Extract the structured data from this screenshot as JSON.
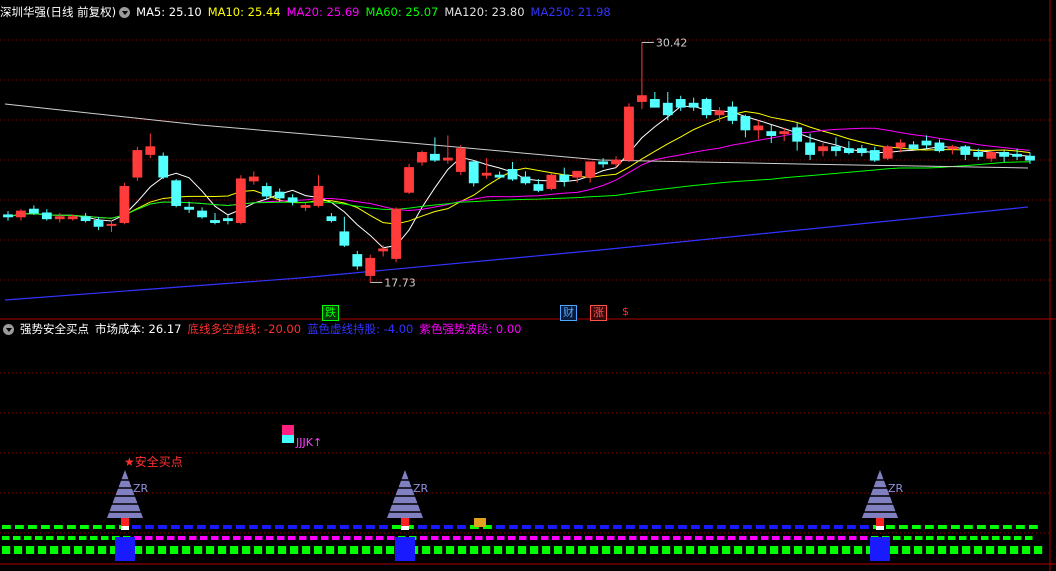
{
  "main": {
    "title": "深圳华强(日线 前复权)",
    "ma": [
      {
        "label": "MA5: 25.10",
        "color": "#ffffff"
      },
      {
        "label": "MA10: 25.44",
        "color": "#ffff00"
      },
      {
        "label": "MA20: 25.69",
        "color": "#ff00ff"
      },
      {
        "label": "MA60: 25.07",
        "color": "#00ff00"
      },
      {
        "label": "MA120: 23.80",
        "color": "#e0e0e0"
      },
      {
        "label": "MA250: 21.98",
        "color": "#3333ff"
      }
    ],
    "high_label": "30.42",
    "low_label": "17.73",
    "markers": [
      {
        "text": "跌",
        "color": "#00ff00",
        "bg": "#0a3a0a"
      },
      {
        "text": "财",
        "color": "#4da6ff",
        "bg": "#0a1a3a"
      },
      {
        "text": "涨",
        "color": "#ff5050",
        "bg": "#3a0a0a"
      },
      {
        "text": "$",
        "color": "#ff3030",
        "bg": "transparent"
      }
    ]
  },
  "indicator": {
    "title": "强势安全买点",
    "items": [
      {
        "label": "市场成本: 26.17",
        "color": "#ffffff"
      },
      {
        "label": "底线多空虚线: -20.00",
        "color": "#ff3030"
      },
      {
        "label": "蓝色虚线持股: -4.00",
        "color": "#3333ff"
      },
      {
        "label": "紫色强势波段: 0.00",
        "color": "#ff00ff"
      }
    ],
    "buy_signal": "★安全买点",
    "zr_label": "ZR",
    "jk_label": "JJJK↑"
  },
  "colors": {
    "up": "#ff3b3b",
    "down": "#54ffff",
    "grid": "#8b0000"
  },
  "chart_data": {
    "type": "candlestick",
    "candles": [
      [
        21.3,
        21.5,
        21.0,
        21.2
      ],
      [
        21.2,
        21.6,
        21.0,
        21.5
      ],
      [
        21.6,
        21.8,
        21.3,
        21.4
      ],
      [
        21.4,
        21.6,
        21.0,
        21.1
      ],
      [
        21.1,
        21.4,
        20.9,
        21.2
      ],
      [
        21.1,
        21.3,
        21.0,
        21.2
      ],
      [
        21.2,
        21.4,
        20.9,
        21.0
      ],
      [
        21.0,
        21.2,
        20.5,
        20.7
      ],
      [
        20.8,
        21.0,
        20.4,
        20.8
      ],
      [
        20.9,
        23.0,
        20.8,
        22.8
      ],
      [
        23.3,
        24.9,
        23.1,
        24.7
      ],
      [
        24.5,
        25.6,
        24.3,
        24.9
      ],
      [
        24.4,
        24.6,
        23.2,
        23.3
      ],
      [
        23.1,
        23.2,
        21.7,
        21.8
      ],
      [
        21.7,
        22.0,
        21.4,
        21.6
      ],
      [
        21.5,
        21.7,
        21.1,
        21.2
      ],
      [
        21.0,
        21.4,
        20.8,
        20.9
      ],
      [
        21.1,
        21.3,
        20.8,
        21.0
      ],
      [
        20.9,
        23.4,
        20.8,
        23.2
      ],
      [
        23.1,
        23.6,
        22.9,
        23.3
      ],
      [
        22.8,
        23.0,
        22.1,
        22.3
      ],
      [
        22.5,
        22.7,
        22.0,
        22.2
      ],
      [
        22.2,
        22.4,
        21.8,
        22.0
      ],
      [
        21.7,
        21.9,
        21.5,
        21.8
      ],
      [
        21.8,
        23.4,
        21.7,
        22.8
      ],
      [
        21.2,
        21.4,
        20.9,
        21.0
      ],
      [
        20.4,
        21.2,
        19.6,
        19.7
      ],
      [
        19.2,
        19.4,
        18.4,
        18.6
      ],
      [
        18.1,
        19.2,
        17.73,
        19.0
      ],
      [
        19.4,
        19.7,
        19.1,
        19.5
      ],
      [
        19.0,
        21.7,
        18.8,
        21.6
      ],
      [
        22.5,
        24.0,
        22.4,
        23.8
      ],
      [
        24.1,
        24.7,
        23.9,
        24.6
      ],
      [
        24.5,
        25.4,
        24.1,
        24.2
      ],
      [
        24.2,
        25.5,
        24.0,
        24.3
      ],
      [
        23.6,
        25.0,
        23.4,
        24.8
      ],
      [
        24.1,
        24.2,
        22.8,
        23.0
      ],
      [
        23.4,
        24.3,
        23.2,
        23.5
      ],
      [
        23.4,
        23.6,
        23.2,
        23.3
      ],
      [
        23.7,
        24.1,
        23.1,
        23.2
      ],
      [
        23.3,
        23.6,
        22.9,
        23.0
      ],
      [
        22.9,
        23.2,
        22.5,
        22.6
      ],
      [
        22.7,
        23.5,
        22.6,
        23.4
      ],
      [
        23.4,
        23.8,
        22.8,
        23.1
      ],
      [
        23.3,
        23.6,
        23.0,
        23.6
      ],
      [
        23.3,
        23.8,
        23.0,
        24.1
      ],
      [
        24.1,
        24.3,
        23.8,
        24.0
      ],
      [
        24.0,
        24.4,
        23.8,
        24.2
      ],
      [
        24.2,
        27.2,
        24.1,
        27.0
      ],
      [
        27.3,
        30.42,
        26.9,
        27.6
      ],
      [
        27.4,
        27.8,
        27.0,
        27.0
      ],
      [
        27.2,
        27.8,
        26.3,
        26.6
      ],
      [
        27.4,
        27.6,
        26.8,
        27.0
      ],
      [
        27.2,
        27.5,
        26.8,
        27.0
      ],
      [
        27.4,
        27.5,
        26.4,
        26.6
      ],
      [
        26.6,
        27.0,
        26.2,
        26.8
      ],
      [
        27.0,
        27.3,
        26.1,
        26.3
      ],
      [
        26.5,
        26.6,
        25.4,
        25.8
      ],
      [
        25.8,
        26.3,
        25.3,
        26.0
      ],
      [
        25.7,
        26.1,
        25.1,
        25.5
      ],
      [
        25.6,
        25.9,
        25.2,
        25.7
      ],
      [
        25.9,
        26.2,
        24.7,
        25.2
      ],
      [
        25.1,
        25.6,
        24.2,
        24.5
      ],
      [
        24.7,
        25.1,
        24.4,
        24.9
      ],
      [
        24.9,
        25.4,
        24.4,
        24.7
      ],
      [
        24.8,
        25.2,
        24.5,
        24.6
      ],
      [
        24.8,
        25.0,
        24.4,
        24.6
      ],
      [
        24.7,
        24.9,
        24.1,
        24.2
      ],
      [
        24.3,
        25.0,
        24.2,
        24.9
      ],
      [
        24.9,
        25.3,
        24.6,
        25.1
      ],
      [
        25.0,
        25.2,
        24.7,
        24.8
      ],
      [
        25.2,
        25.5,
        24.8,
        25.0
      ],
      [
        25.1,
        25.3,
        24.6,
        24.7
      ],
      [
        24.8,
        25.0,
        24.5,
        24.9
      ],
      [
        24.9,
        25.0,
        24.2,
        24.5
      ],
      [
        24.6,
        24.8,
        24.2,
        24.4
      ],
      [
        24.3,
        24.7,
        24.1,
        24.6
      ],
      [
        24.6,
        24.7,
        24.1,
        24.4
      ],
      [
        24.5,
        24.8,
        24.2,
        24.4
      ],
      [
        24.4,
        24.6,
        24.0,
        24.2
      ]
    ]
  }
}
